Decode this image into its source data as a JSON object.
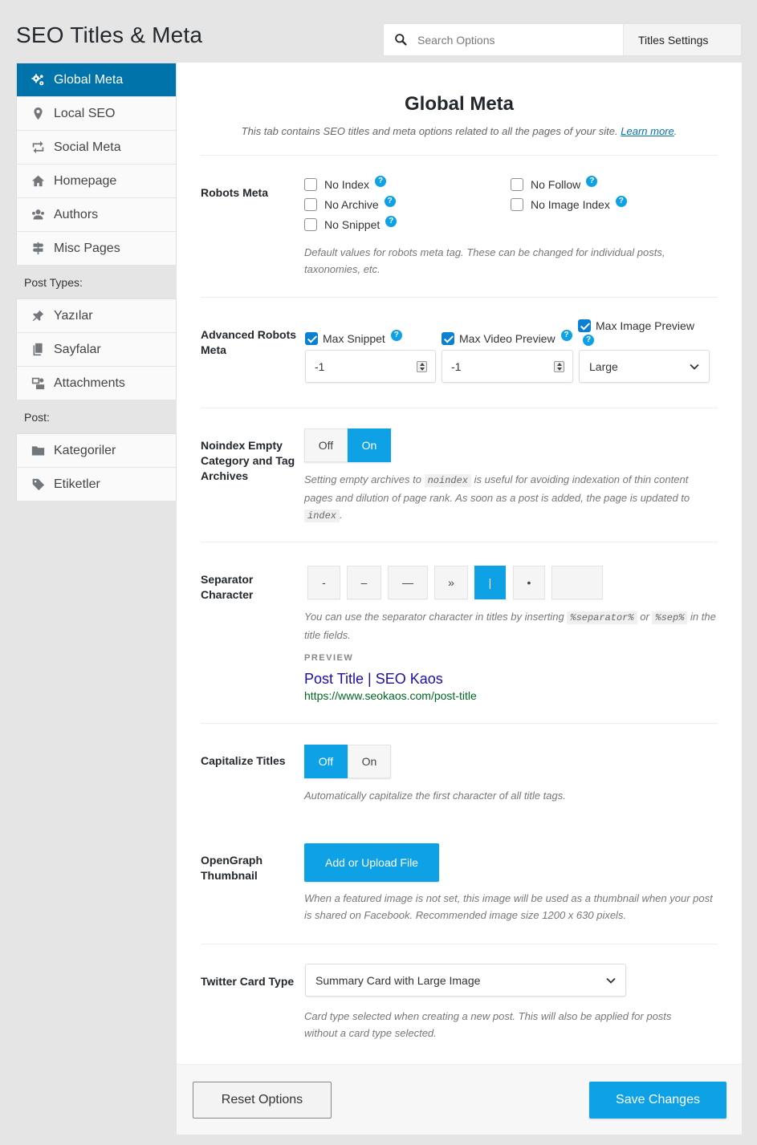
{
  "page": {
    "title": "SEO Titles & Meta"
  },
  "search": {
    "placeholder": "Search Options",
    "section": "Titles Settings"
  },
  "sidebar": {
    "items": [
      {
        "label": "Global Meta",
        "icon": "gears-icon",
        "active": true
      },
      {
        "label": "Local SEO",
        "icon": "map-pin-icon"
      },
      {
        "label": "Social Meta",
        "icon": "retweet-icon"
      },
      {
        "label": "Homepage",
        "icon": "home-icon"
      },
      {
        "label": "Authors",
        "icon": "users-icon"
      },
      {
        "label": "Misc Pages",
        "icon": "signpost-icon"
      }
    ],
    "post_types_heading": "Post Types:",
    "post_types": [
      {
        "label": "Yazılar",
        "icon": "pin-icon"
      },
      {
        "label": "Sayfalar",
        "icon": "pages-icon"
      },
      {
        "label": "Attachments",
        "icon": "media-icon"
      }
    ],
    "post_heading": "Post:",
    "post": [
      {
        "label": "Kategoriler",
        "icon": "folder-icon"
      },
      {
        "label": "Etiketler",
        "icon": "tag-icon"
      }
    ]
  },
  "main": {
    "heading": "Global Meta",
    "intro": "This tab contains SEO titles and meta options related to all the pages of your site.",
    "learn_more": "Learn more",
    "robots": {
      "label": "Robots Meta",
      "options": {
        "no_index": "No Index",
        "no_archive": "No Archive",
        "no_snippet": "No Snippet",
        "no_follow": "No Follow",
        "no_image_index": "No Image Index"
      },
      "description": "Default values for robots meta tag. These can be changed for individual posts, taxonomies, etc."
    },
    "advanced": {
      "label": "Advanced Robots Meta",
      "max_snippet": "Max Snippet",
      "max_video": "Max Video Preview",
      "max_image": "Max Image Preview",
      "snippet_value": "-1",
      "video_value": "-1",
      "image_value": "Large"
    },
    "noindex_empty": {
      "label": "Noindex Empty Category and Tag Archives",
      "off": "Off",
      "on": "On",
      "selected": "On",
      "desc_1": "Setting empty archives to",
      "code_1": "noindex",
      "desc_2": "is useful for avoiding indexation of thin content pages and dilution of page rank. As soon as a post is added, the page is updated to",
      "code_2": "index",
      "desc_3": "."
    },
    "separator": {
      "label": "Separator Character",
      "options": [
        "-",
        "–",
        "—",
        "»",
        "|",
        "•",
        ""
      ],
      "selected": "|",
      "desc_1": "You can use the separator character in titles by inserting",
      "code_1": "%separator%",
      "desc_or": "or",
      "code_2": "%sep%",
      "desc_2": "in the title fields.",
      "preview_label": "PREVIEW",
      "preview_title": "Post Title | SEO Kaos",
      "preview_url": "https://www.seokaos.com/post-title"
    },
    "capitalize": {
      "label": "Capitalize Titles",
      "off": "Off",
      "on": "On",
      "selected": "Off",
      "description": "Automatically capitalize the first character of all title tags."
    },
    "opengraph": {
      "label": "OpenGraph Thumbnail",
      "button": "Add or Upload File",
      "description": "When a featured image is not set, this image will be used as a thumbnail when your post is shared on Facebook. Recommended image size 1200 x 630 pixels."
    },
    "twitter": {
      "label": "Twitter Card Type",
      "value": "Summary Card with Large Image",
      "description": "Card type selected when creating a new post. This will also be applied for posts without a card type selected."
    }
  },
  "footer": {
    "reset": "Reset Options",
    "save": "Save Changes"
  },
  "colors": {
    "accent": "#0ea1e5",
    "active_nav": "#0073aa"
  }
}
